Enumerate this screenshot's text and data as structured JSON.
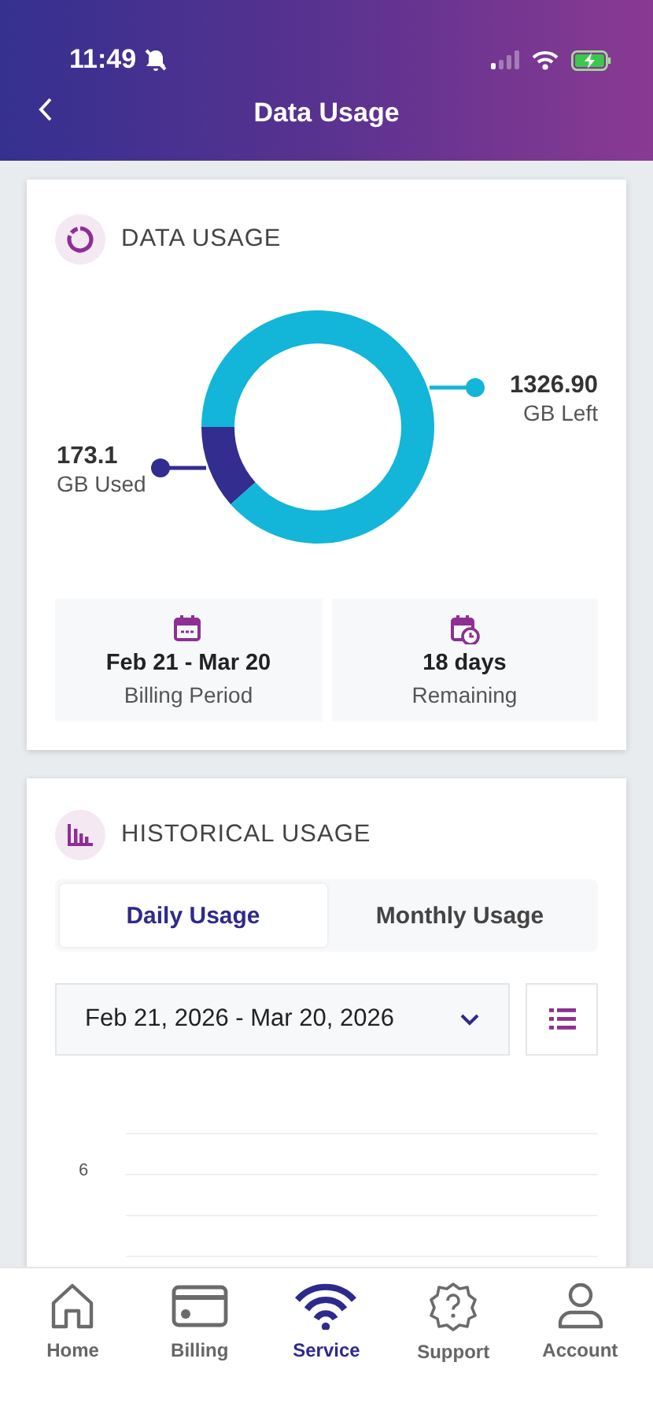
{
  "status_bar": {
    "time": "11:49",
    "silent": true
  },
  "header": {
    "title": "Data Usage"
  },
  "data_usage": {
    "title": "DATA USAGE",
    "chart_data": {
      "type": "donut",
      "categories": [
        "GB Used",
        "GB Left"
      ],
      "values": [
        173.1,
        1326.9
      ],
      "colors": [
        "#332d8f",
        "#13b5d8"
      ],
      "value_labels": [
        "173.1",
        "1326.90"
      ]
    },
    "stats": [
      {
        "kind": "calendar",
        "value": "Feb 21 - Mar 20",
        "label": "Billing Period"
      },
      {
        "kind": "calendar-clock",
        "value": "18 days",
        "label": "Remaining"
      }
    ]
  },
  "historical_usage": {
    "title": "HISTORICAL USAGE",
    "tabs": [
      {
        "label": "Daily Usage",
        "selected": true
      },
      {
        "label": "Monthly Usage",
        "selected": false
      }
    ],
    "date_range": {
      "value": "Feb 21, 2026 - Mar 20, 2026"
    },
    "chart": {
      "y_labels": [
        "6"
      ]
    }
  },
  "nav": [
    {
      "kind": "home",
      "label": "Home",
      "selected": false
    },
    {
      "kind": "card",
      "label": "Billing",
      "selected": false
    },
    {
      "kind": "wifi",
      "label": "Service",
      "selected": true
    },
    {
      "kind": "support",
      "label": "Support",
      "selected": false
    },
    {
      "kind": "account",
      "label": "Account",
      "selected": false
    }
  ]
}
